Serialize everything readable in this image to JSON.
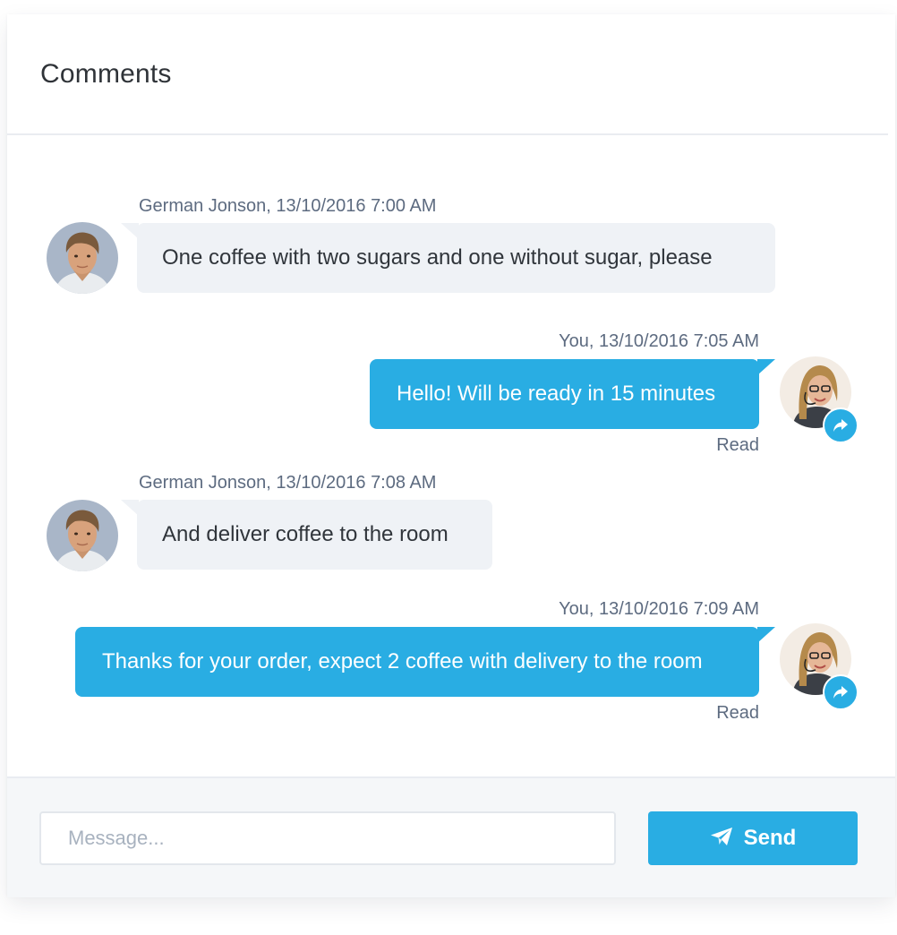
{
  "panel": {
    "title": "Comments"
  },
  "messages": [
    {
      "author_time": "German Jonson, 13/10/2016 7:00 AM",
      "text": "One coffee with two sugars and one without sugar, please"
    },
    {
      "author_time": "You, 13/10/2016 7:05 AM",
      "text": "Hello! Will be ready in 15 minutes",
      "status": "Read"
    },
    {
      "author_time": "German Jonson, 13/10/2016 7:08 AM",
      "text": "And deliver coffee to the room"
    },
    {
      "author_time": "You, 13/10/2016 7:09 AM",
      "text": "Thanks for your order, expect 2 coffee with delivery to the room",
      "status": "Read"
    }
  ],
  "composer": {
    "placeholder": "Message...",
    "send_label": "Send",
    "send_icon": "paper-plane-icon"
  },
  "icons": {
    "reply_badge": "reply-arrow-icon"
  },
  "colors": {
    "accent": "#29ade3",
    "incoming_bubble": "#eff2f6",
    "meta_text": "#5d6b80"
  }
}
